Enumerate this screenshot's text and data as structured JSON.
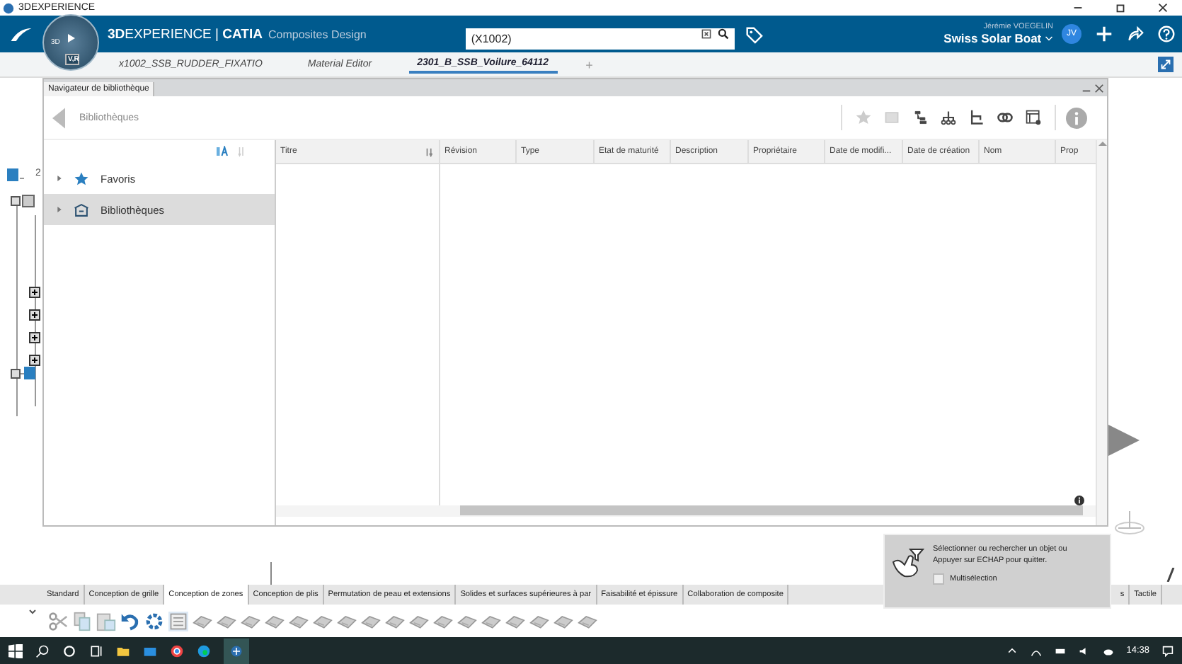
{
  "window": {
    "title": "3DEXPERIENCE"
  },
  "top_bar": {
    "compass": {
      "left": "3D",
      "bottom": "V,R"
    },
    "brand": "**3D**EXPERIENCE | **CATIA**",
    "app": "Composites Design",
    "search": {
      "value": "(X1002)"
    },
    "user": "Jérémie VOEGELIN",
    "collab_space": "Swiss Solar Boat",
    "avatar": "JV"
  },
  "tabs": [
    {
      "label": "x1002_SSB_RUDDER_FIXATIO",
      "selected": false
    },
    {
      "label": "Material Editor",
      "selected": false
    },
    {
      "label": "2301_B_SSB_Voilure_64112",
      "selected": true
    }
  ],
  "add_tab": "+",
  "tree": {
    "root_label": "2"
  },
  "panel": {
    "title": "Navigateur de bibliothèque",
    "breadcrumb": "Bibliothèques",
    "nav_items": [
      {
        "label": "Favoris",
        "kind": "favorites",
        "selected": false
      },
      {
        "label": "Bibliothèques",
        "kind": "libraries",
        "selected": true
      }
    ],
    "columns": [
      {
        "label": "Titre",
        "sortable": true
      },
      {
        "label": "Révision",
        "sortable": false
      },
      {
        "label": "Type",
        "sortable": false
      },
      {
        "label": "Etat de maturité",
        "sortable": false
      },
      {
        "label": "Description",
        "sortable": false
      },
      {
        "label": "Propriétaire",
        "sortable": false
      },
      {
        "label": "Date de modifi...",
        "sortable": false
      },
      {
        "label": "Date de création",
        "sortable": false
      },
      {
        "label": "Nom",
        "sortable": false
      },
      {
        "label": "Prop",
        "sortable": false
      }
    ]
  },
  "workbench_tabs": [
    {
      "label": "Standard",
      "selected": false
    },
    {
      "label": "Conception de grille",
      "selected": false
    },
    {
      "label": "Conception de zones",
      "selected": true
    },
    {
      "label": "Conception de plis",
      "selected": false
    },
    {
      "label": "Permutation de peau et extensions",
      "selected": false
    },
    {
      "label": "Solides et surfaces supérieures à par",
      "selected": false
    },
    {
      "label": "Faisabilité et épissure",
      "selected": false
    },
    {
      "label": "Collaboration de composite",
      "selected": false
    },
    {
      "label": "s",
      "selected": false
    },
    {
      "label": "Tactile",
      "selected": false
    }
  ],
  "dialog": {
    "lines": [
      "Sélectionner ou rechercher un objet ou",
      "Appuyer sur ECHAP pour quitter."
    ],
    "multiselect": {
      "label": "Multisélection",
      "checked": false
    }
  },
  "taskbar": {
    "time": "14:38"
  }
}
